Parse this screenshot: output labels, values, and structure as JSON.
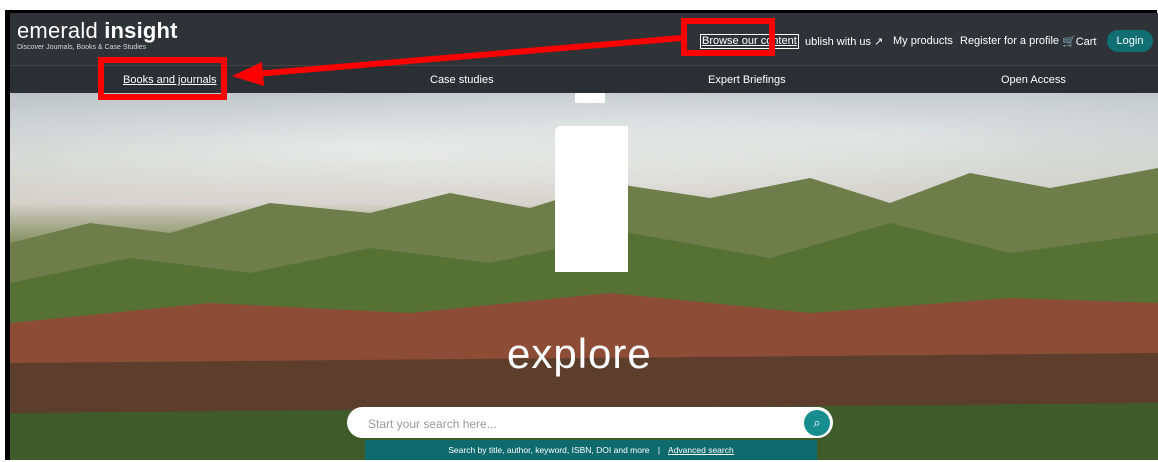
{
  "header": {
    "logo_light": "emerald",
    "logo_bold": "insight",
    "logo_tagline": "Discover Journals, Books & Case Studies",
    "nav": {
      "browse": "Browse our content",
      "publish": "ublish with us",
      "my_products": "My products",
      "register": "Register for a profile",
      "cart": "Cart",
      "login": "Login"
    }
  },
  "subnav": {
    "items": [
      "Books and journals",
      "Case studies",
      "Expert Briefings",
      "Open Access"
    ]
  },
  "hero": {
    "title": "explore",
    "search": {
      "placeholder": "Start your search here...",
      "hint": "Search by title, author, keyword, ISBN, DOI and more",
      "separator": "|",
      "advanced": "Advanced search"
    }
  },
  "colors": {
    "header_bg": "#2f3337",
    "accent_teal": "#0f6f73",
    "annotation_red": "#ff0000"
  },
  "icons": {
    "external": "external-link-icon",
    "cart": "cart-icon",
    "search": "search-icon"
  }
}
